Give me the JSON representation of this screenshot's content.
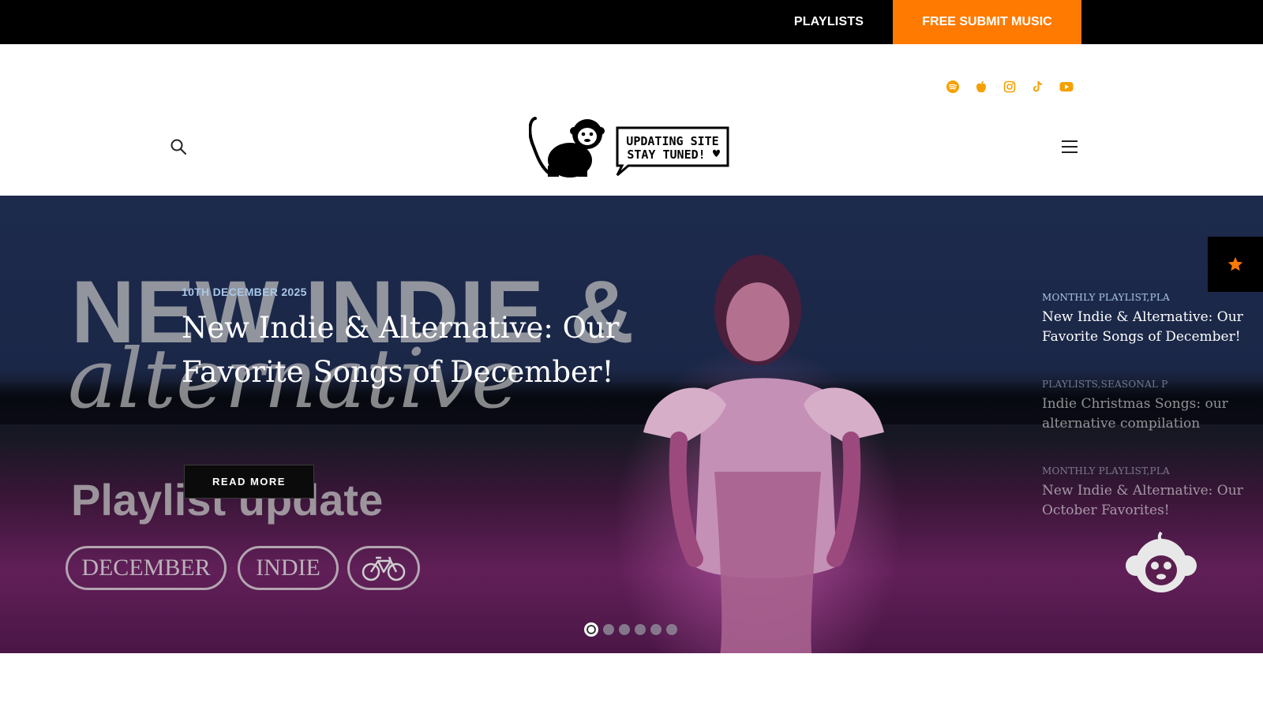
{
  "topbar": {
    "playlists_label": "PLAYLISTS",
    "submit_label": "FREE SUBMIT MUSIC",
    "accent": "#ff7a00"
  },
  "header": {
    "social_icons": [
      "spotify-icon",
      "apple-icon",
      "instagram-icon",
      "tiktok-icon",
      "youtube-icon"
    ],
    "social_color": "#f5a000",
    "logo": {
      "bubble_line1": "UPDATING SITE",
      "bubble_line2": "STAY TUNED!"
    }
  },
  "hero": {
    "bg_text": {
      "line1": "NEW INDIE &",
      "line2": "alternative",
      "line3": "Playlist update",
      "pill1": "DECEMBER",
      "pill2": "INDIE"
    },
    "date": "10TH DECEMBER 2025",
    "title": "New Indie & Alternative: Our Favorite Songs of December!",
    "read_more": "READ MORE",
    "side_items": [
      {
        "category": "MONTHLY PLAYLIST,PLA",
        "title": "New Indie & Alternative: Our Favorite Songs of December!"
      },
      {
        "category": "PLAYLISTS,SEASONAL P",
        "title": "Indie Christmas Songs: our alternative compilation"
      },
      {
        "category": "MONTHLY PLAYLIST,PLA",
        "title": "New Indie & Alternative: Our October Favorites!"
      }
    ],
    "slide_count": 6,
    "active_slide": 1
  }
}
